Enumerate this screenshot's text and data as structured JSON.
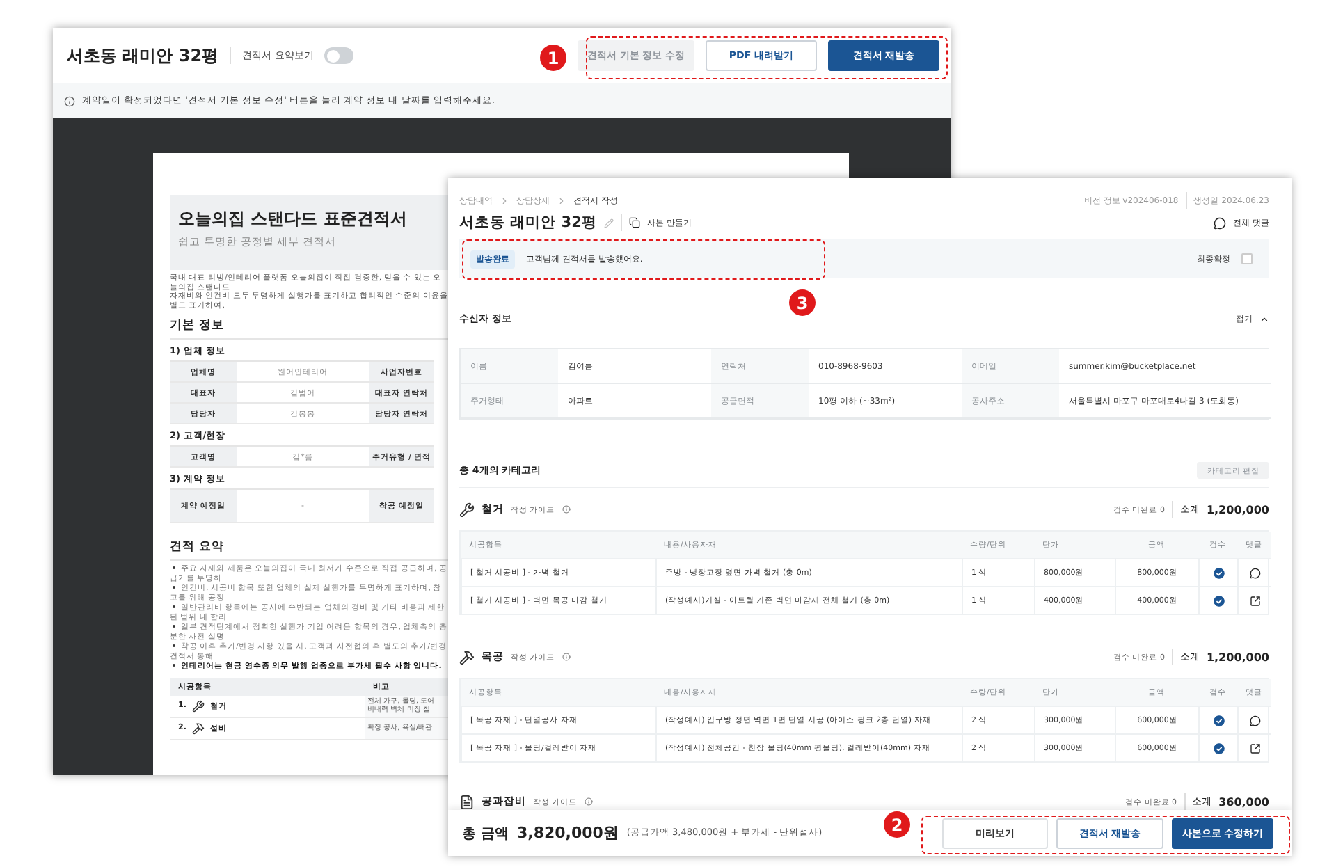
{
  "left_window": {
    "title": "서초동 래미안 32평",
    "summary_toggle": {
      "label": "견적서 요약보기",
      "on": false
    },
    "buttons": [
      {
        "label": "견적서 기본 정보 수정",
        "kind": "disabled"
      },
      {
        "label": "PDF 내려받기",
        "kind": "outline"
      },
      {
        "label": "견적서 재발송",
        "kind": "primary"
      }
    ],
    "notice": "계약일이 확정되었다면 '견적서 기본 정보 수정' 버튼을 눌러 계약 정보 내 날짜를 입력해주세요.",
    "document": {
      "title": "오늘의집 스탠다드 표준견적서",
      "subtitle": "쉽고 투명한 공정별 세부 견적서",
      "intro": [
        "국내 대표 리빙/인테리어 플랫폼 오늘의집이 직접 검증한, 믿을 수 있는 오늘의집 스탠다드 ",
        "자재비와 인건비 모두 투명하게 실행가를 표기하고 합리적인 수준의 이윤을 별도 표기하여,"
      ],
      "basic_heading": "기본 정보",
      "groups": [
        {
          "heading": "1) 업체 정보",
          "rows": [
            [
              "업체명",
              "웬어인테리어",
              "사업자번호"
            ],
            [
              "대표자",
              "김범어",
              "대표자 연락처"
            ],
            [
              "담당자",
              "김봉봉",
              "담당자 연락처"
            ]
          ]
        },
        {
          "heading": "2) 고객/현장",
          "rows": [
            [
              "고객명",
              "김*름",
              "주거유형 / 면적"
            ]
          ]
        },
        {
          "heading": "3) 계약 정보",
          "rows": [
            [
              "계약 예정일",
              "-",
              "착공 예정일"
            ]
          ]
        }
      ],
      "summary_heading": "견적 요약",
      "bullets": [
        {
          "text": "주요 자재와 제품은 오늘의집이 국내 최저가 수준으로 직접 공급하며, 공급가를 투명하",
          "bold": false
        },
        {
          "text": "인건비, 시공비 항목 또한 업체의 실제 실행가를 투명하게 표기하며, 참고를 위해 공정",
          "bold": false
        },
        {
          "text": "일반관리비 항목에는 공사에 수반되는 업체의 경비 및 기타 비용과 제한된 범위 내 합리",
          "bold": false
        },
        {
          "text": "일부 견적단계에서 정확한 실행가 기입 어려운 항목의 경우, 업체측의 충분한 사전 설명",
          "bold": false
        },
        {
          "text": "착공 이후 추가/변경 사항 있을 시, 고객과 사전협의 후 별도의 추가/변경 견적서 통해",
          "bold": false
        },
        {
          "text": "인테리어는 현금 영수증 의무 발행 업종으로 부가세 필수 사항 입니다.",
          "bold": true
        }
      ],
      "summary_columns": [
        "시공항목",
        "비고"
      ],
      "summary_rows": [
        {
          "number": "1.",
          "item": "철거",
          "note": [
            "전체 가구, 몰딩, 도어",
            "비내력 벽체 미장 철"
          ]
        },
        {
          "number": "2.",
          "item": "설비",
          "note": [
            "확장 공사, 욕실/배관"
          ]
        }
      ]
    }
  },
  "right_window": {
    "breadcrumb": [
      "상담내역",
      "상담상세",
      "견적서 작성"
    ],
    "version": "버전 정보 v202406-018",
    "created": "생성일 2024.06.23",
    "title": "서초동 래미안 32평",
    "copy_label": "사본 만들기",
    "comments_label": "전체 댓글",
    "status": {
      "badge": "발송완료",
      "message": "고객님께 견적서를 발송했어요.",
      "final_label": "최종확정",
      "final_checked": false
    },
    "recipient": {
      "heading": "수신자 정보",
      "collapse_label": "접기",
      "rows": [
        [
          {
            "label": "이름",
            "value": "김여름"
          },
          {
            "label": "연락처",
            "value": "010-8968-9603"
          },
          {
            "label": "이메일",
            "value": "summer.kim@bucketplace.net"
          }
        ],
        [
          {
            "label": "주거형태",
            "value": "아파트"
          },
          {
            "label": "공급면적",
            "value": "10평 이하 (~33m²)"
          },
          {
            "label": "공사주소",
            "value": "서울특별시 마포구 마포대로4나길 3 (도화동)"
          }
        ]
      ]
    },
    "category_count": "총 4개의 카테고리",
    "edit_button": {
      "label": "카테고리 편집",
      "disabled": true
    },
    "categories": [
      {
        "name": "철거",
        "guide": "작성 가이드",
        "pending": "검수 미완료 0",
        "subtotal_label": "소계",
        "subtotal": "1,200,000",
        "columns": [
          "시공항목",
          "내용/사용자재",
          "수량/단위",
          "단가",
          "금액",
          "검수",
          "댓글"
        ],
        "rows": [
          {
            "item": "[ 철거 시공비 ] - 가벽 철거",
            "content": "주방 - 냉장고장 옆면 가벽 철거 (총 0m)",
            "qty": "1 식",
            "unit_price": "800,000원",
            "amount": "800,000원",
            "inspected": true,
            "kind": "chat"
          },
          {
            "item": "[ 철거 시공비 ] - 벽면 목공 마감 철거",
            "content": "(작성예시)거실 - 아트월 기존 벽면 마감재 전체 철거 (총 0m)",
            "qty": "1 식",
            "unit_price": "400,000원",
            "amount": "400,000원",
            "inspected": true,
            "kind": "link"
          }
        ]
      },
      {
        "name": "목공",
        "guide": "작성 가이드",
        "pending": "검수 미완료 0",
        "subtotal_label": "소계",
        "subtotal": "1,200,000",
        "columns": [
          "시공항목",
          "내용/사용자재",
          "수량/단위",
          "단가",
          "금액",
          "검수",
          "댓글"
        ],
        "rows": [
          {
            "item": "[ 목공 자재 ] - 단열공사 자재",
            "content": "(작성예시) 입구방 정면 벽면 1면 단열 시공 (아이소 핑크 2층 단열) 자재",
            "qty": "2 식",
            "unit_price": "300,000원",
            "amount": "600,000원",
            "inspected": true,
            "kind": "chat"
          },
          {
            "item": "[ 목공 자재 ] - 몰딩/걸레받이 자재",
            "content": "(작성예시) 전체공간 - 천장 몰딩(40mm 평몰딩), 걸레받이(40mm) 자재",
            "qty": "2 식",
            "unit_price": "300,000원",
            "amount": "600,000원",
            "inspected": true,
            "kind": "link"
          }
        ]
      },
      {
        "name": "공과잡비",
        "guide": "작성 가이드",
        "pending": "검수 미완료 0",
        "subtotal_label": "소계",
        "subtotal": "360,000"
      }
    ],
    "footer": {
      "total_label": "총 금액",
      "total": "3,820,000원",
      "detail": "(공급가액 3,480,000원 + 부가세 - 단위절사)",
      "buttons": [
        {
          "label": "미리보기",
          "kind": "plain"
        },
        {
          "label": "견적서 재발송",
          "kind": "outline"
        },
        {
          "label": "사본으로 수정하기",
          "kind": "primary"
        }
      ]
    }
  },
  "annotations": [
    {
      "number": "1"
    },
    {
      "number": "2"
    },
    {
      "number": "3"
    }
  ]
}
